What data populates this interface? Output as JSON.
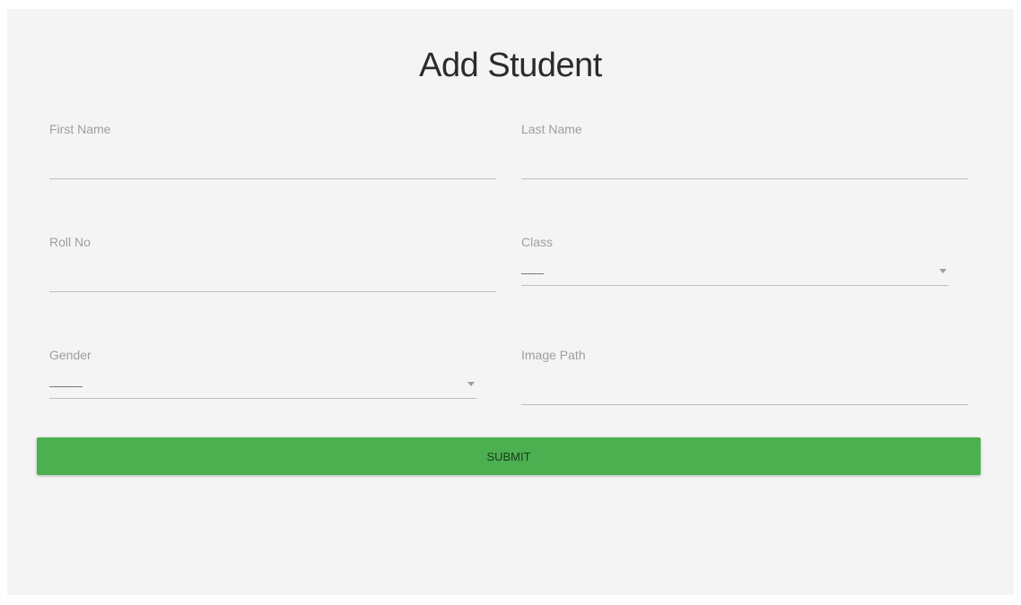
{
  "form": {
    "title": "Add Student",
    "first_name": {
      "label": "First Name",
      "value": ""
    },
    "last_name": {
      "label": "Last Name",
      "value": ""
    },
    "roll_no": {
      "label": "Roll No",
      "value": ""
    },
    "class": {
      "label": "Class",
      "selected": "——"
    },
    "gender": {
      "label": "Gender",
      "selected": "———"
    },
    "image_path": {
      "label": "Image Path",
      "value": ""
    },
    "submit_label": "SUBMIT"
  },
  "colors": {
    "panel_background": "#f4f4f4",
    "submit_button": "#4caf50",
    "underline": "#bdbdbd",
    "label_text": "#9e9e9e"
  },
  "icons": {
    "class_dropdown": "caret-down-icon",
    "gender_dropdown": "caret-down-icon"
  }
}
